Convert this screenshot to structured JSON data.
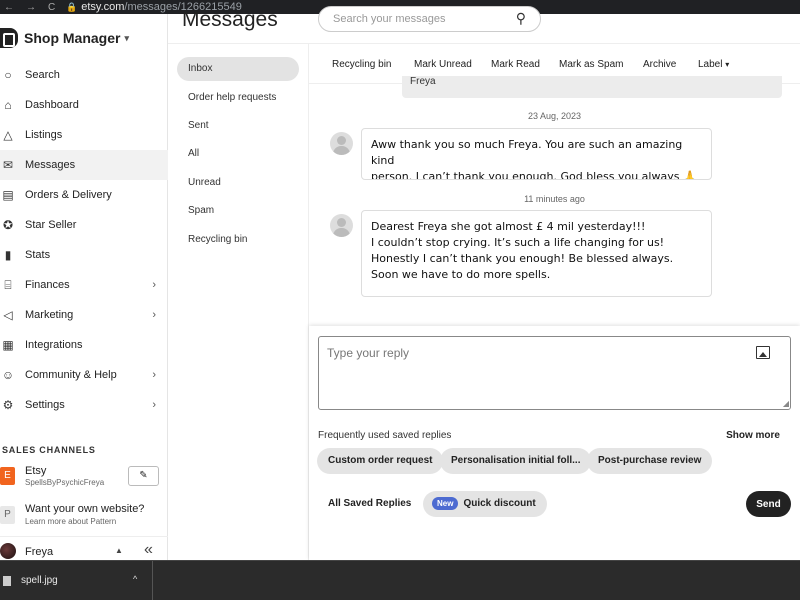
{
  "browser": {
    "url_host": "etsy.com",
    "url_path": "/messages/1266215549"
  },
  "sidebar": {
    "shop_title": "Shop Manager",
    "items": [
      {
        "label": "Search",
        "icon": "search-icon"
      },
      {
        "label": "Dashboard",
        "icon": "home-icon"
      },
      {
        "label": "Listings",
        "icon": "shapes-icon"
      },
      {
        "label": "Messages",
        "icon": "mail-icon"
      },
      {
        "label": "Orders & Delivery",
        "icon": "clipboard-icon"
      },
      {
        "label": "Star Seller",
        "icon": "star-badge-icon"
      },
      {
        "label": "Stats",
        "icon": "bar-chart-icon"
      },
      {
        "label": "Finances",
        "icon": "bank-icon"
      },
      {
        "label": "Marketing",
        "icon": "megaphone-icon"
      },
      {
        "label": "Integrations",
        "icon": "grid-icon"
      },
      {
        "label": "Community & Help",
        "icon": "people-icon"
      },
      {
        "label": "Settings",
        "icon": "gear-icon"
      }
    ],
    "sales_channels_label": "SALES CHANNELS",
    "channel": {
      "badge": "E",
      "name": "Etsy",
      "shop": "SpellsByPsychicFreya"
    },
    "pattern": {
      "badge": "P",
      "name": "Want your own website?",
      "sub": "Learn more about Pattern"
    },
    "user": {
      "name": "Freya"
    }
  },
  "header": {
    "title": "Messages",
    "search_placeholder": "Search your messages"
  },
  "folders": [
    "Inbox",
    "Order help requests",
    "Sent",
    "All",
    "Unread",
    "Spam",
    "Recycling bin"
  ],
  "toolbar": {
    "recycling": "Recycling bin",
    "mark_unread": "Mark Unread",
    "mark_read": "Mark Read",
    "mark_spam": "Mark as Spam",
    "archive": "Archive",
    "label": "Label"
  },
  "conversation": {
    "prev_bubble_text": "Freya",
    "messages": [
      {
        "date": "23 Aug, 2023",
        "lines": [
          "Aww thank you so much Freya. You are such an amazing kind",
          "person. I can’t thank you enough. God bless you always 🙏❤️"
        ]
      },
      {
        "date": "11 minutes ago",
        "lines": [
          "Dearest Freya she got almost £ 4 mil yesterday!!!",
          "I couldn’t stop crying. It’s such a life changing for us!",
          "Honestly I can’t thank you enough! Be blessed always.",
          "Soon we have to do more spells."
        ]
      }
    ]
  },
  "reply": {
    "placeholder": "Type your reply",
    "saved_label": "Frequently used saved replies",
    "show_more": "Show more",
    "chips": [
      "Custom order request",
      "Personalisation initial foll...",
      "Post-purchase review"
    ],
    "all_saved": "All Saved Replies",
    "new_badge": "New",
    "quick_discount": "Quick discount",
    "send": "Send"
  },
  "download": {
    "file_name": "spell.jpg"
  }
}
